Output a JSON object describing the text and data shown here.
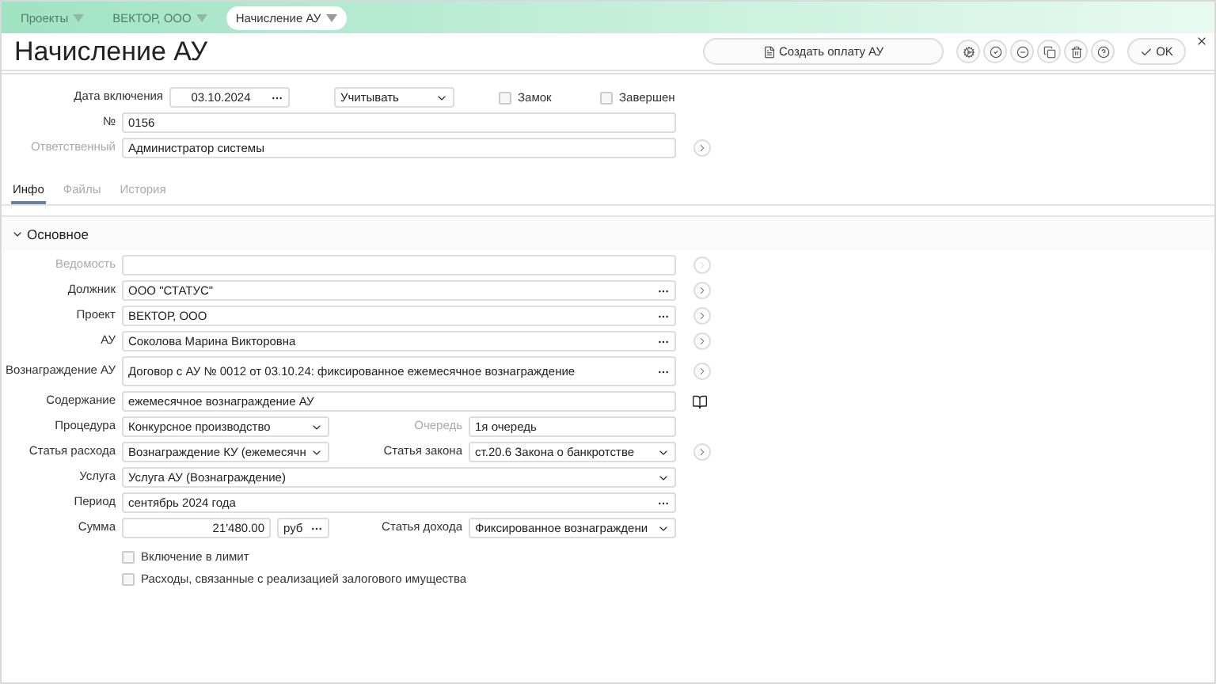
{
  "breadcrumbs": [
    {
      "label": "Проекты",
      "selected": false
    },
    {
      "label": "ВЕКТОР, ООО",
      "selected": false
    },
    {
      "label": "Начисление АУ",
      "selected": true
    }
  ],
  "title": "Начисление АУ",
  "toolbar": {
    "create_button": "Создать оплату АУ",
    "ok_button": "OK"
  },
  "header_form": {
    "date_label": "Дата включения",
    "date_value": "03.10.2024",
    "accounting_value": "Учитывать",
    "checkboxes": [
      {
        "label": "Замок",
        "checked": false
      },
      {
        "label": "Завершен",
        "checked": false
      }
    ],
    "number_label": "№",
    "number_value": "0156",
    "responsible_label": "Ответственный",
    "responsible_disabled": true,
    "responsible_value": "Администратор системы"
  },
  "tabs": [
    {
      "label": "Инфо",
      "selected": true
    },
    {
      "label": "Файлы",
      "selected": false
    },
    {
      "label": "История",
      "selected": false
    }
  ],
  "section": {
    "title": "Основное",
    "expanded": true
  },
  "rows": [
    {
      "label": "Ведомость",
      "disabled": true,
      "field": {
        "kind": "text"
      },
      "action": {
        "kind": "arrow"
      }
    },
    {
      "label": "Должник",
      "disabled": false,
      "field": {
        "kind": "lookup",
        "value": "ООО \"СТАТУС\""
      },
      "action": {
        "kind": "arrow"
      }
    },
    {
      "label": "Проект",
      "disabled": false,
      "field": {
        "kind": "lookup",
        "value": "ВЕКТОР, ООО"
      },
      "action": {
        "kind": "arrow"
      }
    },
    {
      "label": "АУ",
      "disabled": false,
      "field": {
        "kind": "lookup",
        "value": "Соколова Марина Викторовна"
      },
      "action": {
        "kind": "arrow"
      }
    },
    {
      "label": "Вознаграждение АУ",
      "disabled": false,
      "field": {
        "kind": "lookup",
        "value": "Договор с АУ № 0012 от 03.10.24: фиксированное ежемесячное вознаграждение"
      },
      "action": {
        "kind": "arrow"
      }
    },
    {
      "label": "Содержание",
      "disabled": false,
      "field": {
        "kind": "text",
        "value": "ежемесячное вознаграждение АУ"
      },
      "action": {
        "kind": "book"
      }
    },
    {
      "label": "Процедура",
      "disabled": false,
      "field": {
        "kind": "select",
        "value": "Конкурсное производство"
      },
      "side": {
        "label": "Очередь",
        "disabled": true,
        "field": {
          "kind": "text",
          "value": "1я очередь"
        }
      }
    },
    {
      "label": "Статья расхода",
      "disabled": false,
      "field": {
        "kind": "select",
        "value": "Вознаграждение КУ (ежемесячн"
      },
      "side": {
        "label": "Статья закона",
        "disabled": false,
        "field": {
          "kind": "select",
          "value": "ст.20.6 Закона о банкротстве"
        }
      },
      "action": {
        "kind": "arrow"
      }
    },
    {
      "label": "Услуга",
      "disabled": false,
      "field": {
        "kind": "select",
        "value": "Услуга АУ (Вознаграждение)"
      }
    },
    {
      "label": "Период",
      "disabled": false,
      "field": {
        "kind": "lookup",
        "value": "сентябрь 2024 года"
      }
    },
    {
      "label": "Сумма",
      "disabled": false,
      "field": {
        "kind": "amount",
        "value": "21'480.00",
        "currency": "руб"
      },
      "side": {
        "label": "Статья дохода",
        "disabled": false,
        "field": {
          "kind": "select",
          "value": "Фиксированное вознаграждени"
        }
      }
    }
  ],
  "options": [
    {
      "label": "Включение в лимит",
      "checked": false
    },
    {
      "label": "Расходы, связанные с реализацией залогового имущества",
      "checked": false
    }
  ]
}
